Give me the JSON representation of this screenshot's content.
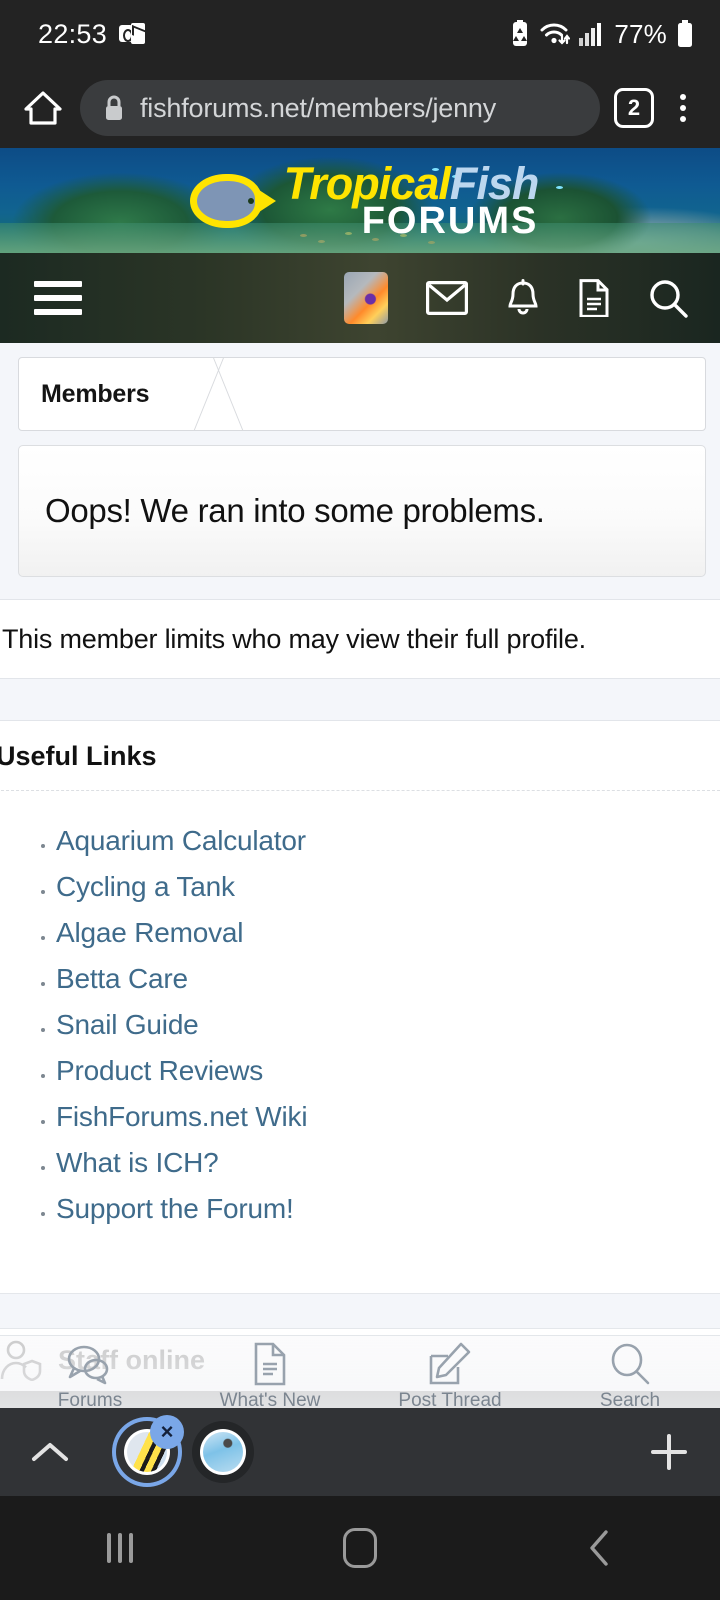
{
  "status_bar": {
    "time": "22:53",
    "battery_percent": "77%",
    "icons": [
      "outlook-icon",
      "battery-saver-icon",
      "wifi-icon",
      "signal-icon",
      "battery-icon"
    ]
  },
  "browser": {
    "url": "fishforums.net/members/jenny",
    "tab_count": "2",
    "home_label": "home-button",
    "menu_label": "browser-menu"
  },
  "site_header": {
    "logo_part1": "Tropical",
    "logo_part2": "Fish",
    "logo_part3": "FORUMS"
  },
  "forum_nav": {
    "menu": "menu",
    "avatar": "account",
    "inbox": "inbox",
    "alerts": "alerts",
    "threads": "threads",
    "search": "search"
  },
  "breadcrumb": {
    "items": [
      "Members"
    ]
  },
  "error_panel": {
    "title": "Oops! We ran into some problems."
  },
  "notice": {
    "text": "This member limits who may view their full profile."
  },
  "useful_links": {
    "heading": "Useful Links",
    "items": [
      "Aquarium Calculator",
      "Cycling a Tank",
      "Algae Removal",
      "Betta Care",
      "Snail Guide",
      "Product Reviews",
      "FishForums.net Wiki",
      "What is ICH?",
      "Support the Forum!"
    ]
  },
  "staff_online": {
    "label": "Staff online"
  },
  "mobile_nav": {
    "items": [
      {
        "label": "Forums",
        "icon": "chat-bubbles-icon"
      },
      {
        "label": "What's New",
        "icon": "document-icon"
      },
      {
        "label": "Post Thread",
        "icon": "compose-icon"
      },
      {
        "label": "Search",
        "icon": "search-icon"
      }
    ]
  },
  "tab_strip": {
    "collapse": "chevron-up",
    "new_tab": "+",
    "close_badge": "×",
    "tabs": [
      "fishforums-tab",
      "second-tab"
    ]
  },
  "system_nav": {
    "recents": "recents",
    "home": "home",
    "back": "back"
  },
  "colors": {
    "link": "#3f6b8b",
    "accent_yellow": "#ffe400",
    "accent_blue": "#bcd7ef",
    "tab_ring": "#7aa7e8"
  }
}
